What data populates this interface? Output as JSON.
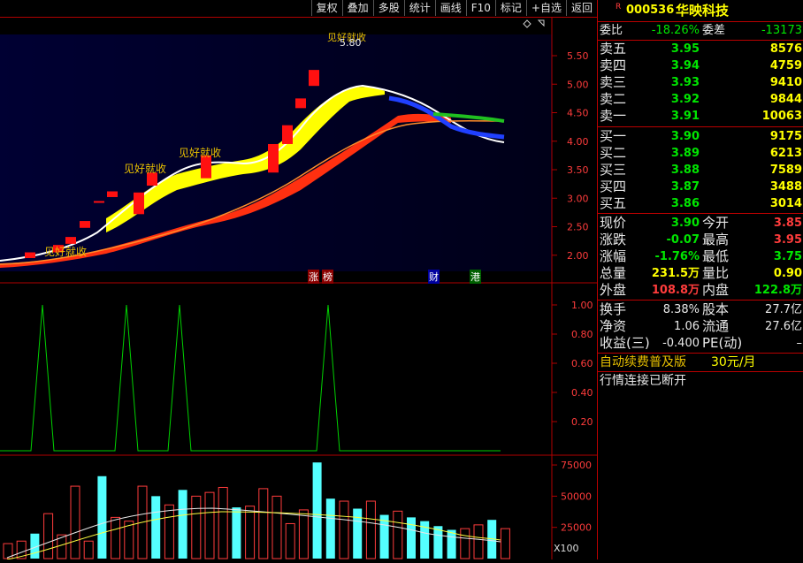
{
  "toolbar": {
    "buttons": [
      "复权",
      "叠加",
      "多股",
      "统计",
      "画线",
      "F10",
      "标记",
      "+自选",
      "返回"
    ]
  },
  "stock": {
    "r_mark": "R",
    "code": "000536",
    "name": "华映科技"
  },
  "weibi": {
    "label": "委比",
    "value": "-18.26%",
    "label2": "委差",
    "value2": "-13173"
  },
  "sell": [
    {
      "label": "卖五",
      "price": "3.95",
      "vol": "8576"
    },
    {
      "label": "卖四",
      "price": "3.94",
      "vol": "4759"
    },
    {
      "label": "卖三",
      "price": "3.93",
      "vol": "9410"
    },
    {
      "label": "卖二",
      "price": "3.92",
      "vol": "9844"
    },
    {
      "label": "卖一",
      "price": "3.91",
      "vol": "10063"
    }
  ],
  "buy": [
    {
      "label": "买一",
      "price": "3.90",
      "vol": "9175"
    },
    {
      "label": "买二",
      "price": "3.89",
      "vol": "6213"
    },
    {
      "label": "买三",
      "price": "3.88",
      "vol": "7589"
    },
    {
      "label": "买四",
      "price": "3.87",
      "vol": "3488"
    },
    {
      "label": "买五",
      "price": "3.86",
      "vol": "3014"
    }
  ],
  "quote": [
    {
      "l1": "现价",
      "v1": "3.90",
      "l2": "今开",
      "v2": "3.85",
      "c1": "green",
      "c2": "red"
    },
    {
      "l1": "涨跌",
      "v1": "-0.07",
      "l2": "最高",
      "v2": "3.95",
      "c1": "green",
      "c2": "red"
    },
    {
      "l1": "涨幅",
      "v1": "-1.76%",
      "l2": "最低",
      "v2": "3.75",
      "c1": "green",
      "c2": "green"
    },
    {
      "l1": "总量",
      "v1": "231.5万",
      "l2": "量比",
      "v2": "0.90",
      "c1": "yellow",
      "c2": "yellow"
    },
    {
      "l1": "外盘",
      "v1": "108.8万",
      "l2": "内盘",
      "v2": "122.8万",
      "c1": "red",
      "c2": "green"
    }
  ],
  "fund": [
    {
      "l1": "换手",
      "v1": "8.38%",
      "l2": "股本",
      "v2": "27.7亿"
    },
    {
      "l1": "净资",
      "v1": "1.06",
      "l2": "流通",
      "v2": "27.6亿"
    },
    {
      "l1": "收益(三)",
      "v1": "-0.400",
      "l2": "PE(动)",
      "v2": "–"
    }
  ],
  "notice": {
    "text1": "自动续费普及版",
    "price": "30元/月",
    "text2": "行情连接已断开"
  },
  "main_chart": {
    "annotations": [
      "见好就收",
      "见好就收",
      "见好就收",
      "见好就收"
    ],
    "peak_label": "5.80",
    "markers": [
      "涨",
      "榜",
      "财",
      "港"
    ],
    "y_ticks": [
      "5.50",
      "5.00",
      "4.50",
      "4.00",
      "3.50",
      "3.00",
      "2.50",
      "2.00"
    ]
  },
  "signal_chart": {
    "y_ticks": [
      "1.00",
      "0.80",
      "0.60",
      "0.40",
      "0.20"
    ]
  },
  "volume_chart": {
    "y_ticks": [
      "75000",
      "50000",
      "25000"
    ],
    "unit": "X100"
  },
  "colors": {
    "up": "#ff3c3c",
    "down": "#00e600",
    "cyan": "#54ffff",
    "border": "#b00000"
  },
  "chart_data": {
    "type": "bar",
    "volume_values": [
      12000,
      14000,
      20000,
      36000,
      19000,
      58000,
      14000,
      66000,
      33000,
      30000,
      58000,
      50000,
      43000,
      55000,
      50000,
      53000,
      57000,
      41000,
      42000,
      56000,
      50000,
      28000,
      39000,
      77000,
      48000,
      46000,
      40000,
      46000,
      35000,
      38000,
      33000,
      30000,
      26000,
      23000,
      24000,
      27000,
      31000,
      24000
    ],
    "volume_up": [
      true,
      true,
      false,
      true,
      true,
      true,
      true,
      false,
      true,
      true,
      true,
      false,
      true,
      false,
      true,
      true,
      true,
      false,
      true,
      true,
      true,
      true,
      true,
      false,
      false,
      true,
      false,
      true,
      false,
      true,
      false,
      false,
      false,
      false,
      true,
      true,
      false,
      true
    ],
    "signal_peaks_x": [
      48,
      143,
      203,
      371
    ],
    "ylim_volume": [
      0,
      80000
    ],
    "ylim_signal": [
      0,
      1.1
    ]
  }
}
